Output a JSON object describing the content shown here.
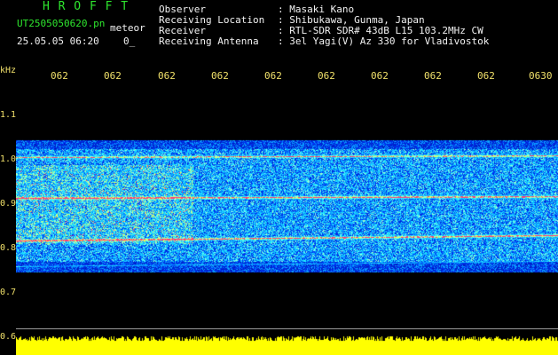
{
  "header": {
    "app_name": "H R O F F T",
    "file_name": "UT2505050620.pn",
    "meteor_label": "meteor",
    "datetime": "25.05.05 06:20",
    "count": "0_",
    "info_rows": [
      {
        "key": "Observer",
        "value": ": Masaki Kano"
      },
      {
        "key": "Receiving Location",
        "value": ": Shibukawa, Gunma, Japan"
      },
      {
        "key": "Receiver",
        "value": ": RTL-SDR SDR# 43dB L15 103.2MHz CW"
      },
      {
        "key": "Receiving Antenna",
        "value": ": 3el Yagi(V) Az 330 for Vladivostok"
      }
    ]
  },
  "plot": {
    "unit": "kHz",
    "time_ticks": [
      "062",
      "062",
      "062",
      "062",
      "062",
      "062",
      "062",
      "062",
      "062",
      "0630"
    ],
    "freq_ticks": [
      "1.1",
      "1.0",
      "0.9",
      "0.8",
      "0.7",
      "0.6"
    ],
    "colors": {
      "label": "#f0e06a",
      "header_green": "#2ee62e",
      "signal_red": "#ff3b7a",
      "noise_yellow": "#ffff00"
    }
  }
}
